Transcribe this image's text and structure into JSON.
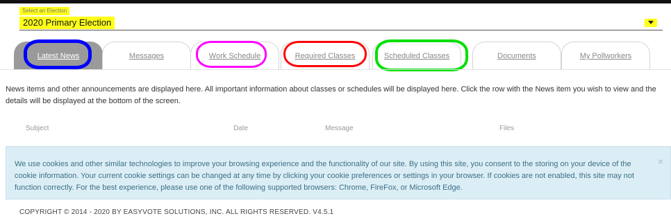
{
  "election_select": {
    "label": "Select an Election",
    "value": "2020 Primary Election"
  },
  "tabs": [
    {
      "label": "Latest News",
      "active": true,
      "highlight": "#0000ff"
    },
    {
      "label": "Messages",
      "active": false
    },
    {
      "label": "Work Schedule",
      "active": false,
      "highlight": "#ff00ff"
    },
    {
      "label": "Required Classes",
      "active": false,
      "highlight": "#ff0000"
    },
    {
      "label": "Scheduled Classes",
      "active": false,
      "highlight": "#00e000"
    },
    {
      "label": "Documents",
      "active": false
    },
    {
      "label": "My Pollworkers",
      "active": false
    }
  ],
  "intro_text": "News items and other announcements are displayed here. All important information about classes or schedules will be displayed here. Click the row with the News item you wish to view and the details will be displayed at the bottom of the screen.",
  "news_table": {
    "columns": [
      "Subject",
      "Date",
      "Message",
      "Files"
    ]
  },
  "cookie_banner": {
    "text": "We use cookies and other similar technologies to improve your browsing experience and the functionality of our site. By using this site, you consent to the storing on your device of the cookie information. Your current cookie settings can be changed at any time by clicking your cookie preferences or settings in your browser. If cookies are not enabled, this site may not function correctly. For the best experience, please use one of the following supported browsers: Chrome, FireFox, or Microsoft Edge.",
    "close_symbol": "×"
  },
  "footer": {
    "copyright": "COPYRIGHT © 2014 - 2020 BY EASYVOTE SOLUTIONS, INC. ALL RIGHTS RESERVED. V4.5.1"
  },
  "colors": {
    "highlight_yellow": "#ffff1a",
    "active_tab": "#9a9a9a",
    "cookie_bg": "#dceef5",
    "cookie_text": "#3b6f88"
  }
}
